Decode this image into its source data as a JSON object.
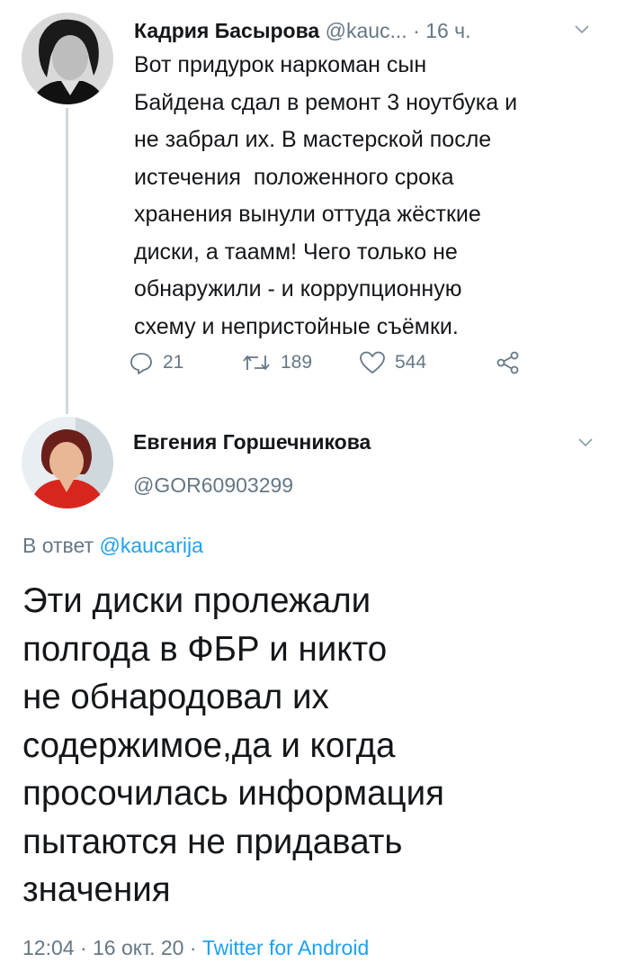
{
  "tweet1": {
    "author_name": "Кадрия Басырова",
    "handle": "@kauc...",
    "separator": " · ",
    "time": "16 ч.",
    "text_lines": [
      "Вот придурок наркоман сын",
      "Байдена сдал в ремонт 3 ноутбука и",
      "не забрал их. В мастерской после",
      "истечения  положенного срока",
      "хранения вынули оттуда жёсткие",
      "диски, а таамм! Чего только не",
      "обнаружили - и коррупционную",
      "схему и непристойные съёмки."
    ],
    "replies": "21",
    "retweets": "189",
    "likes": "544"
  },
  "tweet2": {
    "author_name": "Евгения Горшечникова",
    "handle": "@GOR60903299",
    "reply_prefix": "В ответ ",
    "reply_mention": "@kaucarija",
    "text_lines": [
      "Эти диски пролежали",
      "полгода в ФБР и никто",
      "не обнародовал их",
      "содержимое,да и когда",
      "просочилась информация",
      "пытаются не придавать",
      "значения"
    ],
    "timestamp": "12:04 · 16 окт. 20 · ",
    "source": "Twitter for Android"
  },
  "icons": {
    "reply": "reply-icon",
    "retweet": "retweet-icon",
    "like": "heart-icon",
    "share": "share-icon",
    "caret": "chevron-down-icon"
  },
  "colors": {
    "text": "#14171a",
    "secondary": "#657786",
    "link": "#1da1f2",
    "thread_line": "#cfd9de"
  }
}
